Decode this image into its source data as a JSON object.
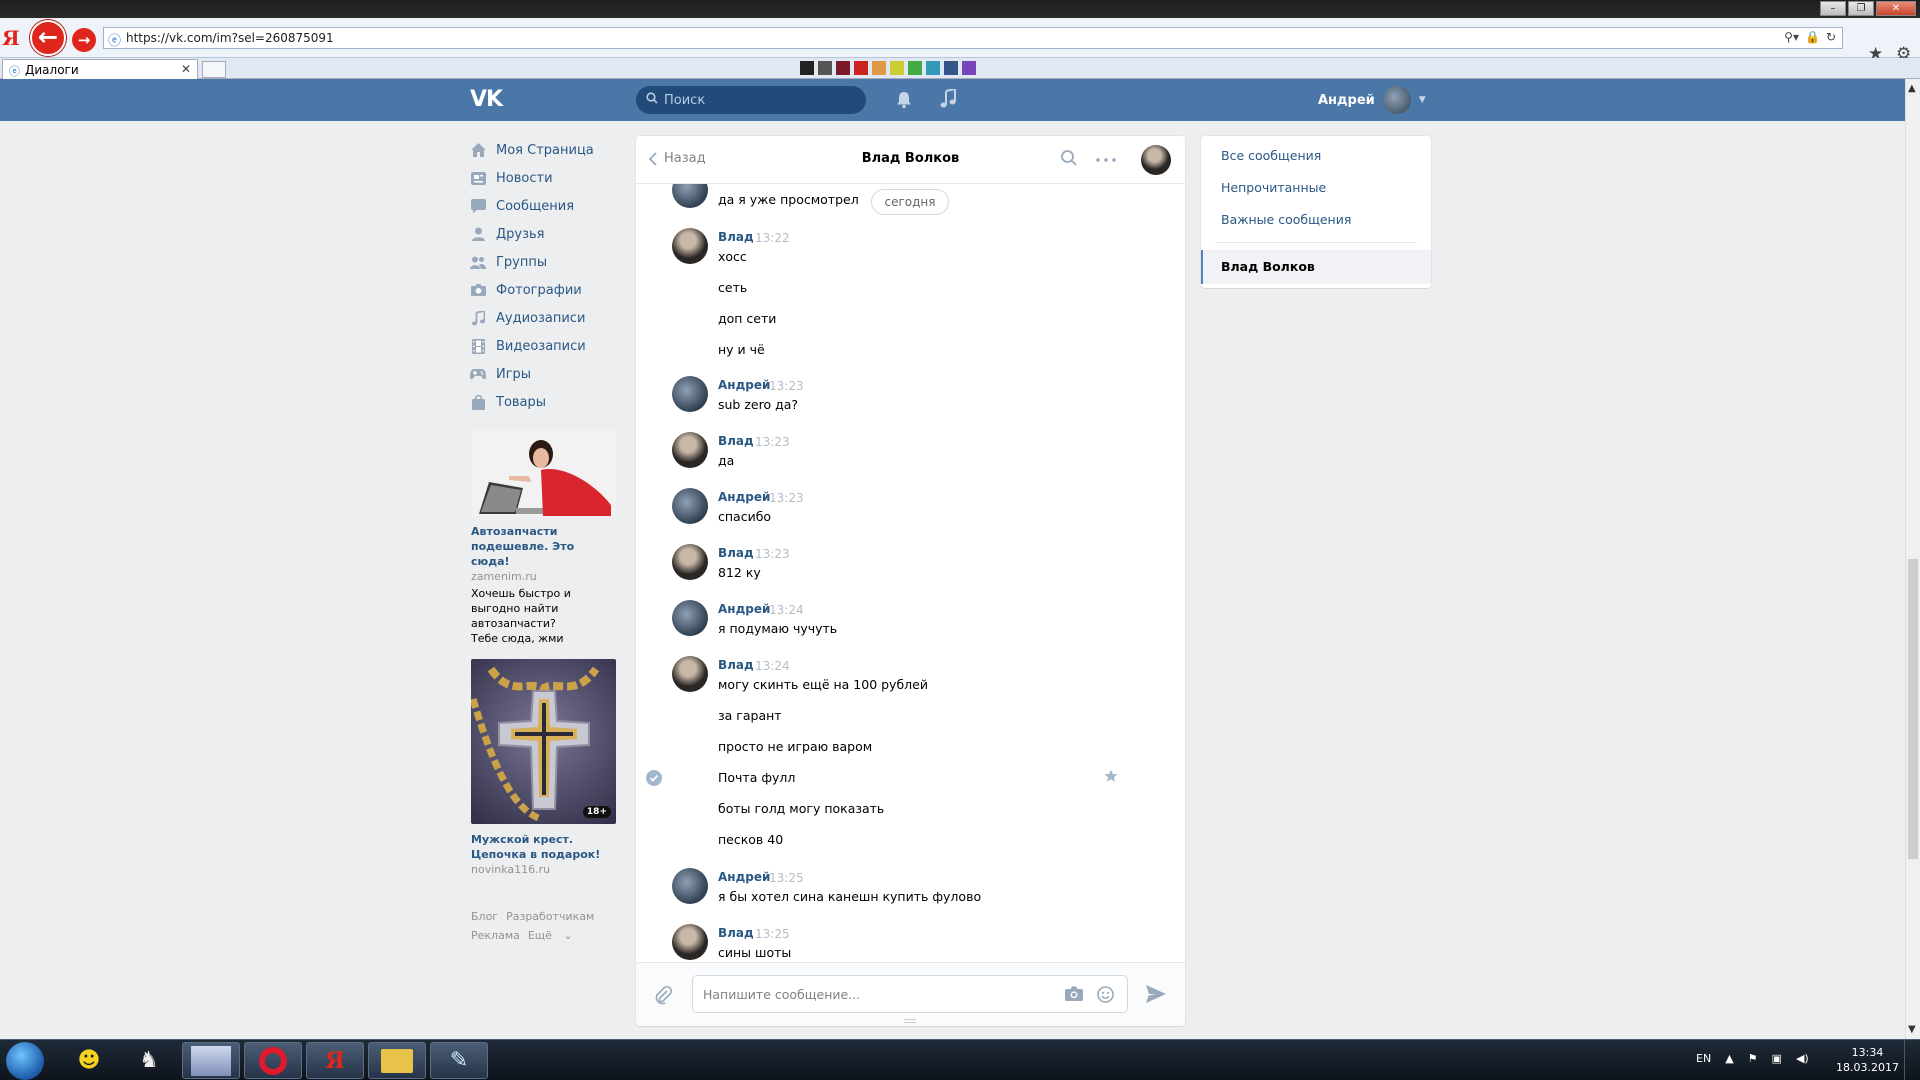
{
  "browser": {
    "url": "https://vk.com/im?sel=260875091",
    "tab_title": "Диалоги",
    "logo_letter": "Я"
  },
  "header": {
    "search_placeholder": "Поиск",
    "user_name": "Андрей"
  },
  "left_nav": [
    {
      "label": "Моя Страница",
      "icon": "home-icon"
    },
    {
      "label": "Новости",
      "icon": "news-icon"
    },
    {
      "label": "Сообщения",
      "icon": "messages-icon"
    },
    {
      "label": "Друзья",
      "icon": "friends-icon"
    },
    {
      "label": "Группы",
      "icon": "groups-icon"
    },
    {
      "label": "Фотографии",
      "icon": "camera-icon"
    },
    {
      "label": "Аудиозаписи",
      "icon": "music-note-icon"
    },
    {
      "label": "Видеозаписи",
      "icon": "film-icon"
    },
    {
      "label": "Игры",
      "icon": "gamepad-icon"
    },
    {
      "label": "Товары",
      "icon": "shopping-bag-icon"
    }
  ],
  "ads": [
    {
      "title_line1": "Автозапчасти",
      "title_line2": "подешевле. Это сюда!",
      "domain": "zamenim.ru",
      "desc": [
        "Хочешь быстро и",
        "выгодно найти",
        "автозапчасти?",
        "Тебе сюда, жми"
      ]
    },
    {
      "title_line1": "Мужской крест.",
      "title_line2": "Цепочка в подарок!",
      "domain": "novinka116.ru",
      "age": "18+"
    }
  ],
  "footer": {
    "blog": "Блог",
    "developers": "Разработчикам",
    "ads": "Реклама",
    "more": "Ещё"
  },
  "chat": {
    "back_label": "Назад",
    "title": "Влад Волков",
    "day_badge": "сегодня",
    "messages": [
      {
        "text": "да я уже просмотрел"
      },
      {
        "author": "Влад",
        "time": "13:22",
        "texts": [
          "хосс",
          "сеть",
          "доп сети",
          "ну и чё"
        ]
      },
      {
        "author": "Андрей",
        "time": "13:23",
        "texts": [
          "sub zero да?"
        ]
      },
      {
        "author": "Влад",
        "time": "13:23",
        "texts": [
          "да"
        ]
      },
      {
        "author": "Андрей",
        "time": "13:23",
        "texts": [
          "спасибо"
        ]
      },
      {
        "author": "Влад",
        "time": "13:23",
        "texts": [
          "812 ку"
        ]
      },
      {
        "author": "Андрей",
        "time": "13:24",
        "texts": [
          "я подумаю чучуть"
        ]
      },
      {
        "author": "Влад",
        "time": "13:24",
        "texts": [
          "могу скинть ещё на 100 рублей",
          "за гарант",
          "просто не играю варом",
          "Почта фулл",
          "боты голд могу показать",
          "песков 40"
        ]
      },
      {
        "author": "Андрей",
        "time": "13:25",
        "texts": [
          "я бы хотел сина канешн купить фулово"
        ]
      },
      {
        "author": "Влад",
        "time": "13:25",
        "texts": [
          "сины шоты"
        ]
      }
    ],
    "composer_placeholder": "Напишите сообщение..."
  },
  "right_panel": {
    "all": "Все сообщения",
    "unread": "Непрочитанные",
    "important": "Важные сообщения",
    "active_dialog": "Влад Волков"
  },
  "taskbar": {
    "lang": "EN",
    "time": "13:34",
    "date": "18.03.2017"
  }
}
